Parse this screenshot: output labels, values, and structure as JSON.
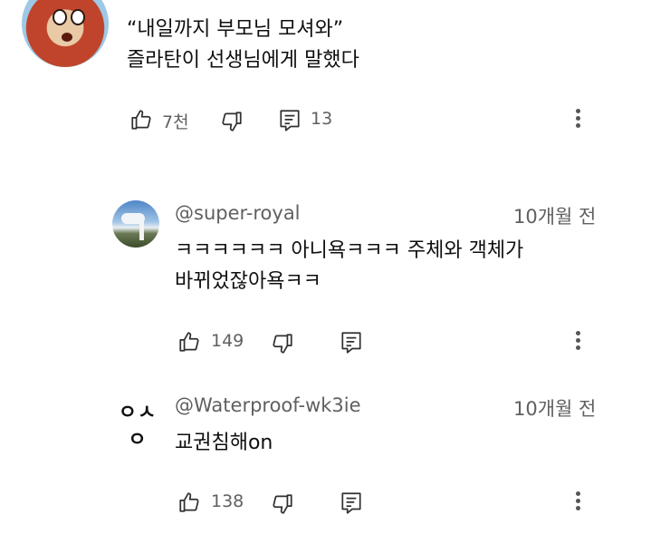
{
  "comments": [
    {
      "id": "main",
      "avatar": "cartoon-monkey-avatar",
      "text_line1": "“내일까지 부모님 모셔와”",
      "text_line2": "즐라탄이 선생님에게 말했다",
      "likes": "7천",
      "replies": "13"
    },
    {
      "id": "reply1",
      "avatar": "sky-photo-avatar",
      "handle": "@super-royal",
      "date": "10개월 전",
      "text_line1": "ㅋㅋㅋㅋㅋㅋ 아니욕ㅋㅋㅋ 주체와 객체가",
      "text_line2": "바뀌었잖아욕ㅋㅋ",
      "likes": "149"
    },
    {
      "id": "reply2",
      "avatar_text": "ㅇㅅㅇ",
      "handle": "@Waterproof-wk3ie",
      "date": "10개월 전",
      "text_line1": "교권침해on",
      "likes": "138"
    }
  ],
  "icons": [
    "like-icon",
    "dislike-icon",
    "reply-icon",
    "more-options-icon"
  ]
}
